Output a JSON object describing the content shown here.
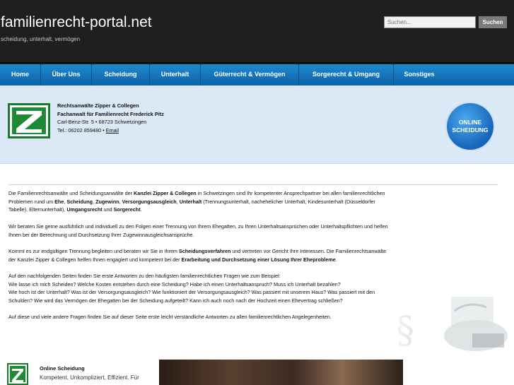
{
  "header": {
    "site_title": "familienrecht-portal.net",
    "tagline": "scheidung, unterhalt, vermögen",
    "search_placeholder": "Suchen...",
    "search_button": "Suchen"
  },
  "nav": {
    "items": [
      {
        "label": "Home"
      },
      {
        "label": "Über Uns"
      },
      {
        "label": "Scheidung"
      },
      {
        "label": "Unterhalt"
      },
      {
        "label": "Güterrecht & Vermögen"
      },
      {
        "label": "Sorgerecht & Umgang"
      },
      {
        "label": "Sonstiges"
      }
    ]
  },
  "banner": {
    "firm_name": "Rechtsanwälte Zipper & Collegen",
    "specialist": "Fachanwalt für Familienrecht Frederick Pitz",
    "address": "Carl-Benz-Str. 5 • 68723 Schwetzingen",
    "phone": "Tel.: 06202 859480 •",
    "email_label": "Email",
    "badge_line1": "ONLINE",
    "badge_line2": "SCHEIDUNG"
  },
  "content": {
    "p1_a": "Die Familienrechtsanwälte und Scheidungsanwälte der ",
    "p1_b": "Kanzlei Zipper & Collegen",
    "p1_c": " in Schwetzingen sind Ihr kompetenter Ansprechpartner bei allen familienrechtlichen Problemen rund um ",
    "p1_d": "Ehe",
    "p1_e": ", ",
    "p1_f": "Scheidung",
    "p1_g": ", ",
    "p1_h": "Zugewinn",
    "p1_i": ", ",
    "p1_j": "Versorgungsausgleich",
    "p1_k": ", ",
    "p1_l": "Unterhalt",
    "p1_m": " (Trennungsunterhalt, nachehelicher Unterhalt, Kindesunterhalt (Düsseldorfer Tabelle), Elternunterhalt), ",
    "p1_n": "Umgangsrecht",
    "p1_o": " und ",
    "p1_p": "Sorgerecht",
    "p1_q": ".",
    "p2": "Wir beraten Sie gerne ausführlich und individuell zu den Folgen einer Trennung von Ihrem Ehegatten, zu Ihren Unterhaltsansprüchen oder Unterhaltspflichten und helfen Ihnen bei der Berechnung und Durchsetzung Ihrer Zugewinnausgleichsansprüche.",
    "p3_a": "Kommt es zur endgültigen Trennung begleiten und beraten wir Sie in Ihrem ",
    "p3_b": "Scheidungsverfahren",
    "p3_c": " und vertreten vor Gericht Ihre Interessen. Die Familienrechtsanwälte der Kanzlei Zipper & Collegen helfen Ihnen engagiert und kompetent bei der ",
    "p3_d": "Erarbeitung und Durchsetzung einer Lösung Ihrer Eheprobleme",
    "p3_e": ".",
    "p4_l1": "Auf den nachfolgenden Seiten finden Sie erste Antworten zu den häufigsten familienrechtlichen Fragen wie zum Beispiel:",
    "p4_l2": "Wie lasse ich mich Scheiden? Welche Kosten entstehen durch eine Scheidung? Habe ich einen Unterhaltsanspruch? Muss ich Unterhalt bezahlen?",
    "p4_l3": "Wie hoch ist der Unterhalt? Was ist der Versorgungsausgleich? Wie funktioniert der Versorgungsausgleich? Was passiert mit unserem Haus? Was passiert mit den Schulden? Wie wird das Vermögen der Ehegatten bei der Scheidung aufgeteilt? Kann ich auch noch nach der Hochzeit einen Ehevertrag schließen?",
    "p5": "Auf diese und viele andere Fragen finden Sie auf dieser Seite erste leicht verständliche Antworten zu allen familienrechtlichen Angelegenheiten."
  },
  "bottom": {
    "title": "Online Scheidung",
    "text": "Kompetent, Unkompliziert, Effizient. Für"
  }
}
